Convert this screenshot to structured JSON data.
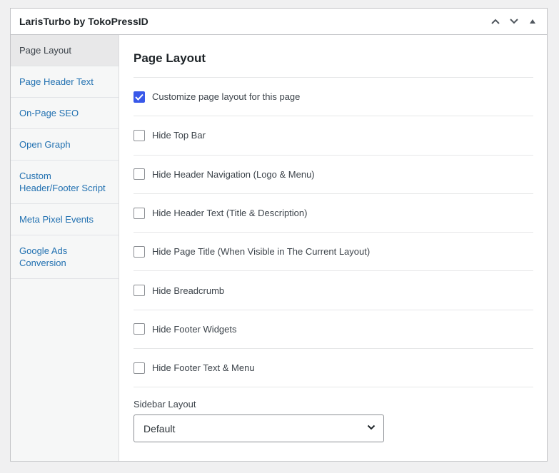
{
  "metabox": {
    "title": "LarisTurbo by TokoPressID",
    "actions": [
      {
        "name": "move-up-icon"
      },
      {
        "name": "move-down-icon"
      },
      {
        "name": "toggle-panel-icon"
      }
    ]
  },
  "sidebar": {
    "items": [
      {
        "label": "Page Layout",
        "active": true
      },
      {
        "label": "Page Header Text",
        "active": false
      },
      {
        "label": "On-Page SEO",
        "active": false
      },
      {
        "label": "Open Graph",
        "active": false
      },
      {
        "label": "Custom\nHeader/Footer Script",
        "active": false
      },
      {
        "label": "Meta Pixel Events",
        "active": false
      },
      {
        "label": "Google Ads\nConversion",
        "active": false
      }
    ]
  },
  "panel": {
    "title": "Page Layout",
    "options": [
      {
        "label": "Customize page layout for this page",
        "checked": true
      },
      {
        "label": "Hide Top Bar",
        "checked": false
      },
      {
        "label": "Hide Header Navigation (Logo & Menu)",
        "checked": false
      },
      {
        "label": "Hide Header Text (Title & Description)",
        "checked": false
      },
      {
        "label": "Hide Page Title (When Visible in The Current Layout)",
        "checked": false
      },
      {
        "label": "Hide Breadcrumb",
        "checked": false
      },
      {
        "label": "Hide Footer Widgets",
        "checked": false
      },
      {
        "label": "Hide Footer Text & Menu",
        "checked": false
      }
    ],
    "sidebar_layout": {
      "label": "Sidebar Layout",
      "selected": "Default"
    }
  },
  "colors": {
    "accent": "#3858e9",
    "link": "#2271b1"
  }
}
